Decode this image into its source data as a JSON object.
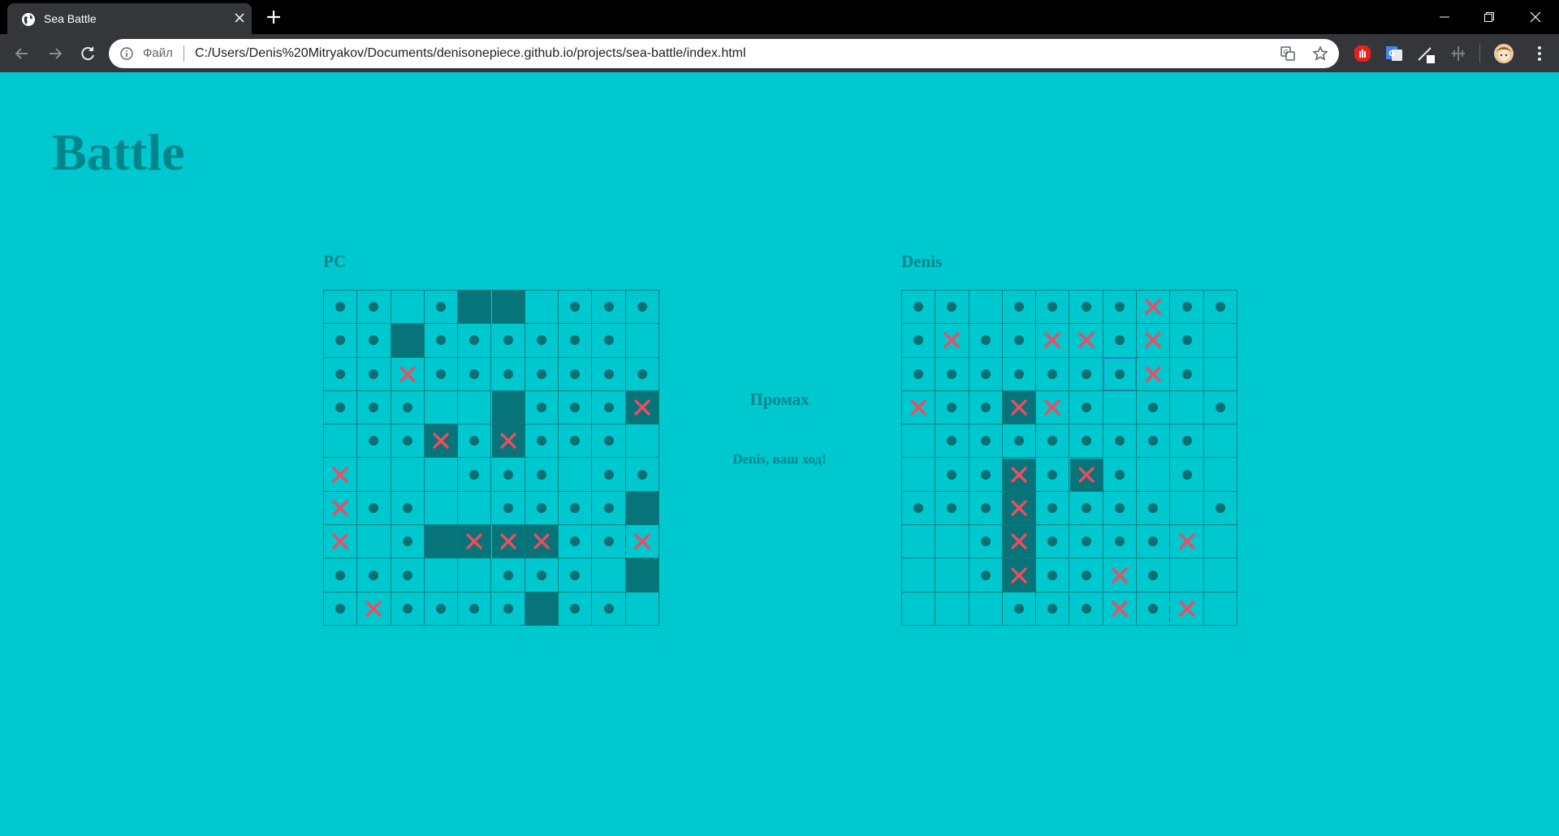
{
  "browser": {
    "tab_title": "Sea Battle",
    "scheme_label": "Файл",
    "url": "C:/Users/Denis%20Mitryakov/Documents/denisonepiece.github.io/projects/sea-battle/index.html"
  },
  "page": {
    "title": "Battle",
    "status_main": "Промах",
    "status_sub": "Denis, ваш ход!"
  },
  "boards": [
    {
      "label": "PC",
      "grid": [
        "oo.oSS.ooo",
        "ooSoooooo.",
        "ooXooooooo",
        "ooo..Sooo+",
        ".oo+o+ooo.",
        "X...ooo.oo",
        "Xoo..oooo S",
        "X.oS+++ooX",
        "ooo..ooo.S",
        "oXooooSoo."
      ]
    },
    {
      "label": "Denis",
      "grid": [
        "oo.ooooXoo",
        "oXooXXoXo.",
        "ooooooOXo.",
        "Xoo+Xo.o.o",
        ".oooooooo.",
        ".oo+o+o.o.",
        "ooo+oooo.o",
        "..o+ooooX.",
        "..o+ooXo..",
        "...oooXoX."
      ]
    }
  ]
}
